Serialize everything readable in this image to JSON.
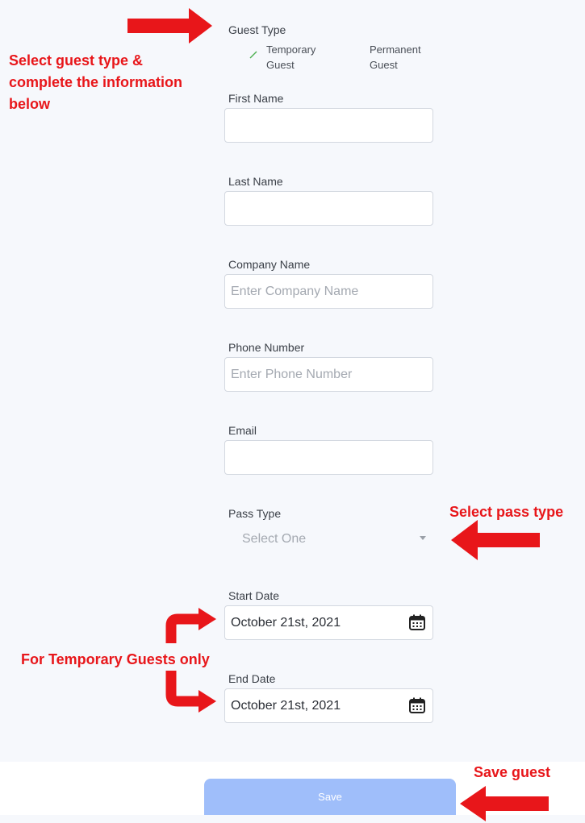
{
  "form": {
    "guest_type_label": "Guest Type",
    "guest_type_options": [
      {
        "line1": "Temporary",
        "line2": "Guest",
        "selected": true
      },
      {
        "line1": "Permanent",
        "line2": "Guest",
        "selected": false
      }
    ],
    "first_name": {
      "label": "First Name",
      "value": "",
      "placeholder": ""
    },
    "last_name": {
      "label": "Last Name",
      "value": "",
      "placeholder": ""
    },
    "company_name": {
      "label": "Company Name",
      "value": "",
      "placeholder": "Enter Company Name"
    },
    "phone_number": {
      "label": "Phone Number",
      "value": "",
      "placeholder": "Enter Phone Number"
    },
    "email": {
      "label": "Email",
      "value": "",
      "placeholder": ""
    },
    "pass_type": {
      "label": "Pass Type",
      "value": "Select One"
    },
    "start_date": {
      "label": "Start Date",
      "value": "October 21st, 2021"
    },
    "end_date": {
      "label": "End Date",
      "value": "October 21st, 2021"
    },
    "save_label": "Save"
  },
  "annotations": {
    "guest_type_line1": "Select guest type &",
    "guest_type_line2": "complete the  information",
    "guest_type_line3": "below",
    "pass_type": "Select pass type",
    "temporary_only": "For Temporary Guests only",
    "save": "Save guest"
  },
  "colors": {
    "annotation_red": "#e8161a",
    "save_button": "#9fbefa",
    "check_green": "#4caf50",
    "background": "#f6f8fc"
  },
  "icons": {
    "start_date": "calendar-icon",
    "end_date": "calendar-icon",
    "pass_type": "chevron-down-icon",
    "selected_option": "check-icon"
  }
}
